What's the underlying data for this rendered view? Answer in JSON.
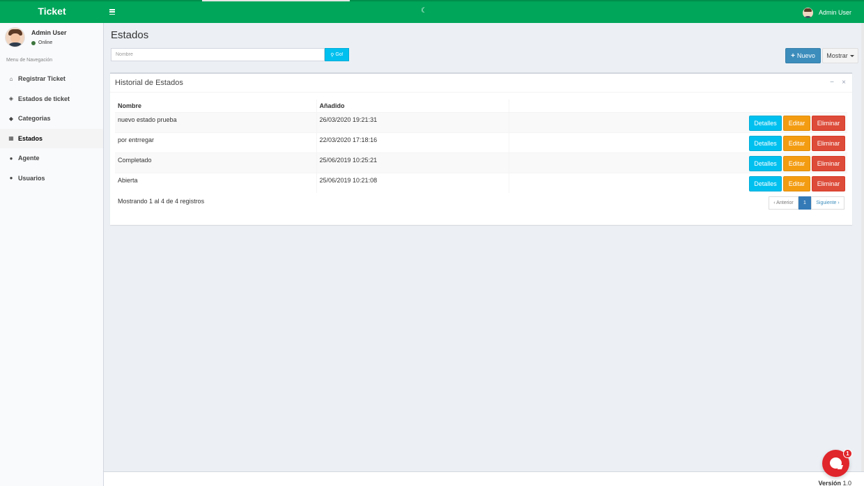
{
  "header": {
    "logo": "Ticket",
    "user_name": "Admin User",
    "loader_glyph": "☾"
  },
  "sidebar": {
    "user_name": "Admin User",
    "status": "Online",
    "nav_header": "Menu de Navegación",
    "items": [
      {
        "label": "Registrar Ticket",
        "icon": "home-icon",
        "glyph": "⌂"
      },
      {
        "label": "Estados de ticket",
        "icon": "ticket-icon",
        "glyph": "◈"
      },
      {
        "label": "Categorias",
        "icon": "tag-icon",
        "glyph": "◆"
      },
      {
        "label": "Estados",
        "icon": "grid-icon",
        "glyph": "▦"
      },
      {
        "label": "Agente",
        "icon": "user-icon",
        "glyph": "●"
      },
      {
        "label": "Usuarios",
        "icon": "users-icon",
        "glyph": "●"
      }
    ]
  },
  "page": {
    "title": "Estados",
    "search_placeholder": "Nombre",
    "go_label": "Go!",
    "nuevo_label": "Nuevo",
    "mostrar_label": "Mostrar"
  },
  "box": {
    "title": "Historial de Estados",
    "columns": [
      "Nombre",
      "Añadido",
      ""
    ],
    "rows": [
      {
        "nombre": "nuevo estado prueba",
        "anadido": "26/03/2020 19:21:31"
      },
      {
        "nombre": "por entrregar",
        "anadido": "22/03/2020 17:18:16"
      },
      {
        "nombre": "Completado",
        "anadido": "25/06/2019 10:25:21"
      },
      {
        "nombre": "Abierta",
        "anadido": "25/06/2019 10:21:08"
      }
    ],
    "actions": {
      "details": "Detalles",
      "edit": "Editar",
      "delete": "Eliminar"
    },
    "info": "Mostrando 1 al 4 de 4 registros",
    "pager": {
      "prev": "‹ Anterior",
      "page": "1",
      "next": "Siguiente ›"
    }
  },
  "footer": {
    "version_label": "Versión",
    "version_value": "1.0"
  },
  "chat": {
    "badge": "1"
  }
}
